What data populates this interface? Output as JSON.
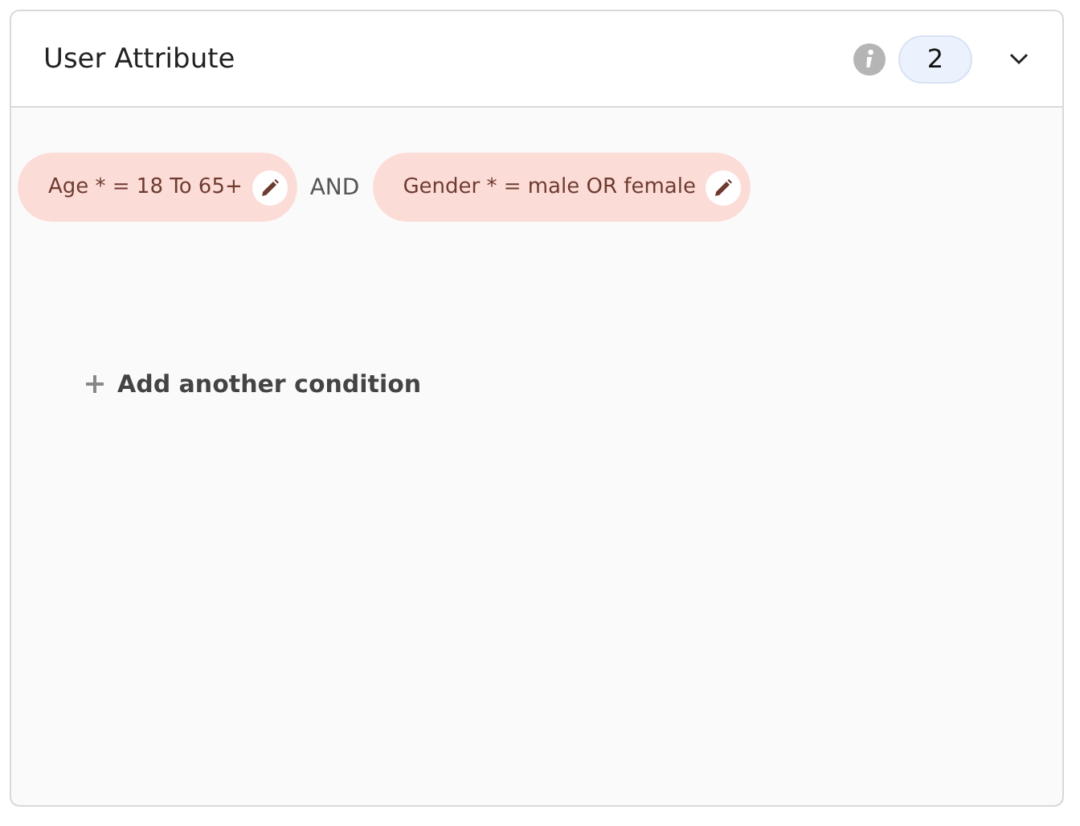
{
  "panel": {
    "title": "User Attribute",
    "count": "2",
    "expanded": true
  },
  "conditions": [
    {
      "label": "Age * = 18 To 65+"
    },
    {
      "label": "Gender * = male OR female"
    }
  ],
  "joiners": [
    "AND"
  ],
  "add_button": {
    "label": "Add another condition"
  }
}
